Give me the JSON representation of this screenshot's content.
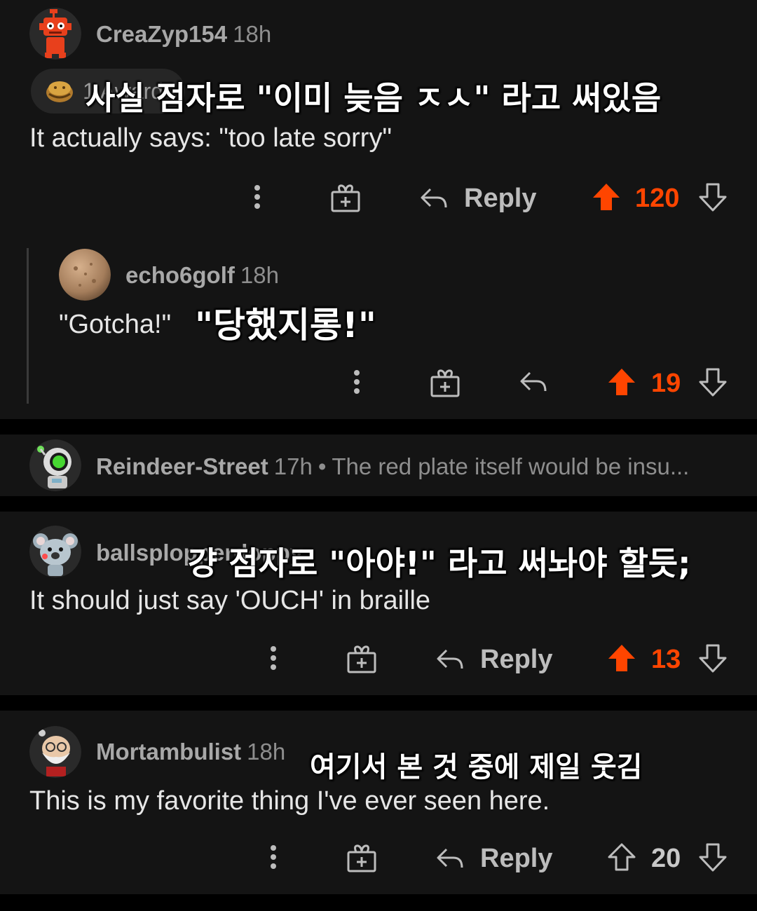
{
  "colors": {
    "background": "#141414",
    "separator": "#000000",
    "upvote_active": "#ff4500",
    "text_muted": "#8e8e8e"
  },
  "comments": [
    {
      "username": "CreaZyp154",
      "time": "18h",
      "avatar": "red-robot-avatar",
      "award_text": "1 Award",
      "overlay_text": "사실 점자로 \"이미 늦음 ㅈㅅ\" 라고 써있음",
      "body": "It actually says: \"too late sorry\"",
      "reply_label": "Reply",
      "score": "120",
      "vote_state": "upvoted"
    },
    {
      "username": "echo6golf",
      "time": "18h",
      "avatar": "stone-texture-avatar",
      "body": "\"Gotcha!\"",
      "overlay_text": "\"당했지롱!\"",
      "score": "19",
      "vote_state": "upvoted"
    },
    {
      "username": "Reindeer-Street",
      "time": "17h",
      "avatar": "green-helmet-avatar",
      "collapsed": true,
      "preview": "The red plate itself would be insu..."
    },
    {
      "username": "ballsplopperdoppy",
      "time": "",
      "avatar": "koala-avatar",
      "overlay_text": "걍 점자로 \"아야!\" 라고 써놔야 할듯;",
      "body": "It should just say 'OUCH' in braille",
      "reply_label": "Reply",
      "score": "13",
      "vote_state": "upvoted"
    },
    {
      "username": "Mortambulist",
      "time": "18h",
      "avatar": "bearded-old-man-avatar",
      "overlay_text": "여기서 본 것 중에 제일 웃김",
      "body": "This is my favorite thing I've ever seen here.",
      "reply_label": "Reply",
      "score": "20",
      "vote_state": "none"
    }
  ]
}
